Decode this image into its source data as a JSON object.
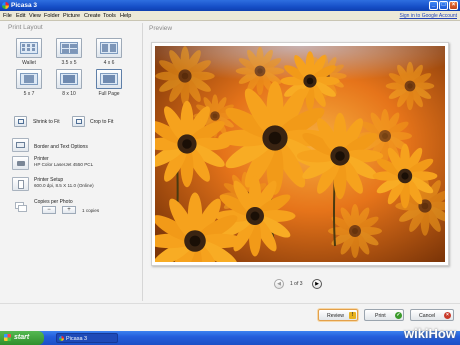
{
  "window": {
    "title": "Picasa 3"
  },
  "menu": {
    "items": [
      "File",
      "Edit",
      "View",
      "Folder",
      "Picture",
      "Create",
      "Tools",
      "Help"
    ],
    "signin": "Sign in to Google Account"
  },
  "print_layout": {
    "title": "Print Layout",
    "layouts": [
      {
        "label": "Wallet",
        "icon": "layout-wallet-icon",
        "selected": false
      },
      {
        "label": "3.5 x 5",
        "icon": "layout-3-5x5-icon",
        "selected": false
      },
      {
        "label": "4 x 6",
        "icon": "layout-4x6-icon",
        "selected": false
      },
      {
        "label": "5 x 7",
        "icon": "layout-5x7-icon",
        "selected": false
      },
      {
        "label": "8 x 10",
        "icon": "layout-8x10-icon",
        "selected": false
      },
      {
        "label": "Full Page",
        "icon": "layout-full-page-icon",
        "selected": true
      }
    ],
    "shrink_to_fit": "Shrink to Fit",
    "crop_to_fit": "Crop to Fit",
    "border_options": "Border and Text Options",
    "printer_label": "Printer",
    "printer_value": "HP Color LaserJet 4550 PCL",
    "setup_label": "Printer Setup",
    "setup_value": "600.0 dpi, 8.5 X 11.0 (Online)",
    "copies_label": "Copies per Photo",
    "copies_value": "1 copies",
    "minus": "−",
    "plus": "+"
  },
  "preview": {
    "title": "Preview",
    "page_indicator": "1 of 3",
    "prev": "◀",
    "next": "▶"
  },
  "actions": {
    "review": "Review",
    "print": "Print",
    "cancel": "Cancel"
  },
  "taskbar": {
    "start": "start",
    "task": "Picasa 3"
  },
  "watermark": {
    "wiki": "wiki",
    "how": "How"
  },
  "colors": {
    "accent": "#245edb",
    "review_border": "#e3a04a",
    "print_icon": "#3a9a2a",
    "cancel_icon": "#c93a2a",
    "review_icon": "#e7b21f"
  }
}
